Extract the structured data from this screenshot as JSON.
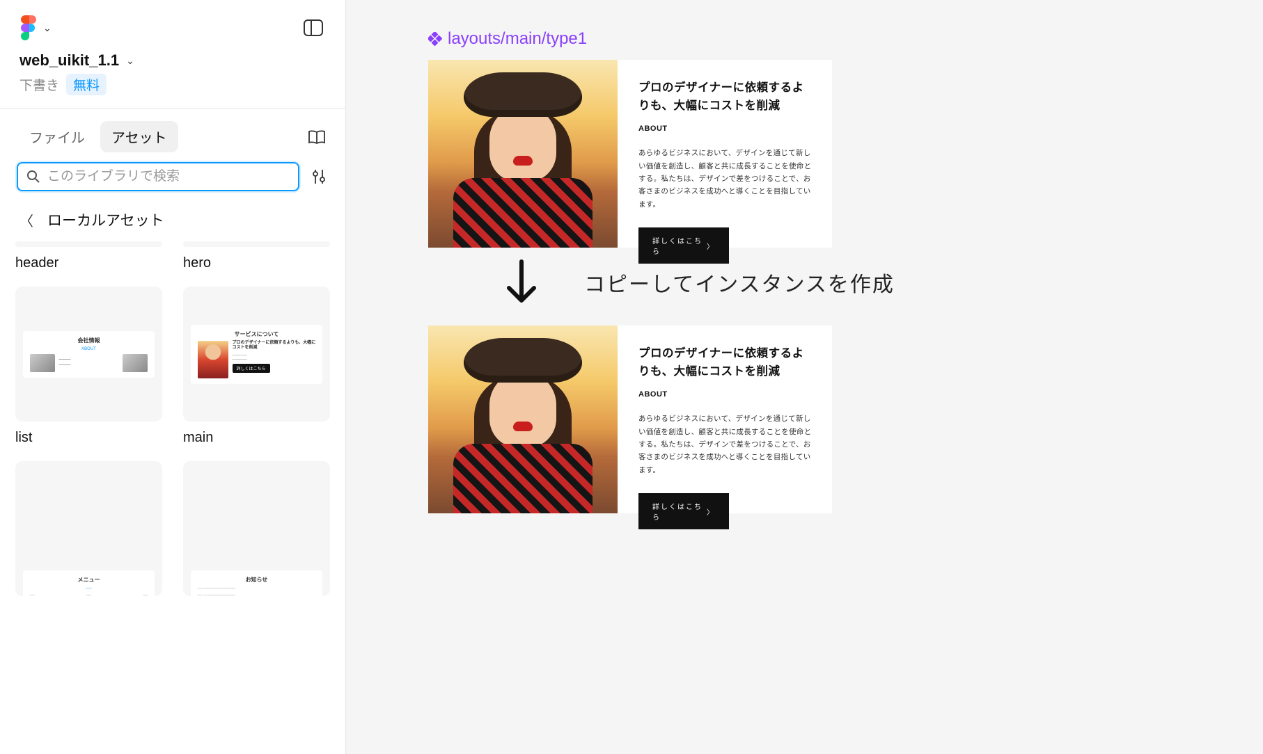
{
  "file": {
    "title": "web_uikit_1.1",
    "draft_label": "下書き",
    "free_badge": "無料"
  },
  "tabs": {
    "file_tab": "ファイル",
    "assets_tab": "アセット"
  },
  "search": {
    "placeholder": "このライブラリで検索"
  },
  "local_assets": {
    "label": "ローカルアセット"
  },
  "assets": [
    {
      "label": "header"
    },
    {
      "label": "hero"
    },
    {
      "label": "list"
    },
    {
      "label": "main"
    },
    {
      "label": ""
    },
    {
      "label": ""
    }
  ],
  "thumb_list": {
    "title": "会社情報",
    "sub": "ABOUT"
  },
  "thumb_main": {
    "title": "サービスについて",
    "heading": "プロのデザイナーに依頼するよりも、大幅にコストを削減",
    "btn": "詳しくはこちら"
  },
  "thumb_menu": {
    "title": "メニュー"
  },
  "thumb_news": {
    "title": "お知らせ"
  },
  "canvas": {
    "component_label": "layouts/main/type1",
    "instruction": "コピーしてインスタンスを作成",
    "layout": {
      "heading": "プロのデザイナーに依頼するよりも、大幅にコストを削減",
      "sub": "ABOUT",
      "body": "あらゆるビジネスにおいて、デザインを通じて新しい価値を創造し、顧客と共に成長することを使命とする。私たちは、デザインで差をつけることで、お客さまのビジネスを成功へと導くことを目指しています。",
      "button": "詳しくはこちら"
    }
  },
  "colors": {
    "accent": "#0d99ff",
    "purple": "#8a3ffc"
  }
}
